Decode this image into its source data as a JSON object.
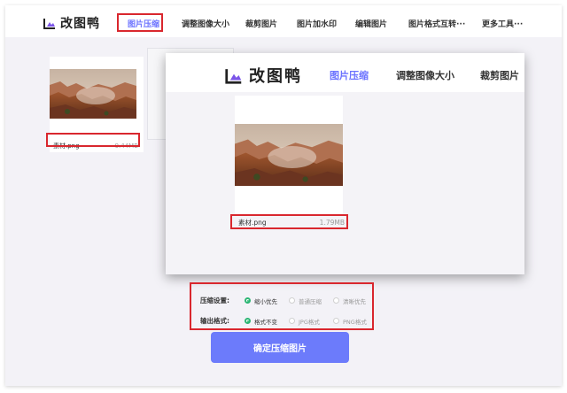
{
  "app": {
    "name": "改图鸭"
  },
  "nav": {
    "items": [
      {
        "label": "图片压缩"
      },
      {
        "label": "调整图像大小"
      },
      {
        "label": "裁剪图片"
      },
      {
        "label": "图片加水印"
      },
      {
        "label": "编辑图片"
      },
      {
        "label": "图片格式互转···"
      },
      {
        "label": "更多工具···"
      }
    ],
    "active_index": 0
  },
  "files": {
    "original": {
      "name": "素材.png",
      "size": "9.44MB"
    },
    "compressed": {
      "name": "素材.png",
      "size": "1.79MB"
    }
  },
  "overlay_nav": {
    "items": [
      {
        "label": "图片压缩"
      },
      {
        "label": "调整图像大小"
      },
      {
        "label": "裁剪图片"
      }
    ]
  },
  "settings": {
    "compression": {
      "label": "压缩设置:",
      "options": [
        "缩小优先",
        "普通压缩",
        "清晰优先"
      ],
      "selected_index": 0
    },
    "output": {
      "label": "输出格式:",
      "options": [
        "格式不变",
        "JPG格式",
        "PNG格式"
      ],
      "selected_index": 0
    }
  },
  "confirm_button": "确定压缩图片",
  "colors": {
    "accent": "#6b72ff",
    "highlight": "#d9272e",
    "radio_on": "#2bb673",
    "button": "#6c7bfb"
  }
}
